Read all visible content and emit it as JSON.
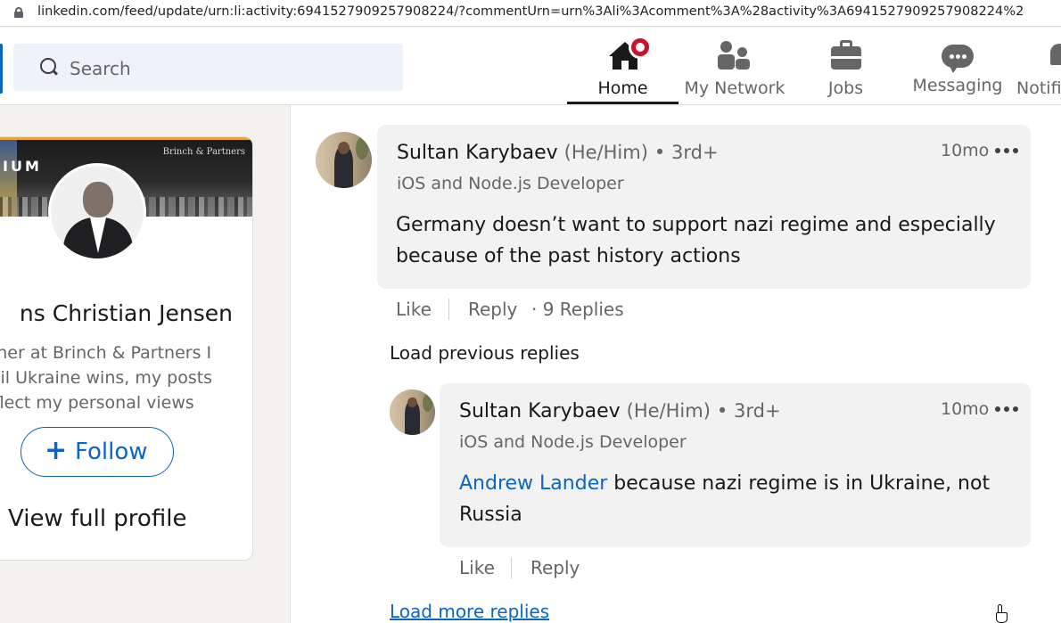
{
  "browser": {
    "url": "linkedin.com/feed/update/urn:li:activity:6941527909257908224/?commentUrn=urn%3Ali%3Acomment%3A%28activity%3A6941527909257908224%2"
  },
  "nav": {
    "search_placeholder": "Search",
    "items": [
      {
        "label": "Home",
        "icon": "home-icon",
        "active": true
      },
      {
        "label": "My Network",
        "icon": "people-icon"
      },
      {
        "label": "Jobs",
        "icon": "briefcase-icon"
      },
      {
        "label": "Messaging",
        "icon": "chat-bubble-icon"
      },
      {
        "label": "Notifi",
        "icon": "bell-icon"
      }
    ],
    "accent_color": "#0a66c2",
    "badge_color": "#cb112d"
  },
  "profile_card": {
    "banner_left_text": "IUM",
    "banner_right_text": "Brinch & Partners",
    "name": "ns Christian Jensen",
    "headline_lines": [
      "rtner at Brinch & Partners I",
      "ntil Ukraine wins, my posts",
      "eflect my personal views"
    ],
    "follow_label": "Follow",
    "follow_plus": "+",
    "view_profile_label": "View full profile"
  },
  "comments": [
    {
      "author": "Sultan Karybaev",
      "pronouns": "(He/Him)",
      "degree": "• 3rd+",
      "headline": "iOS and Node.js Developer",
      "time": "10mo",
      "text_lines": [
        "Germany doesn’t want to support nazi regime and especially",
        "because of the past history actions"
      ],
      "actions": {
        "like": "Like",
        "reply": "Reply",
        "replies": "· 9 Replies"
      }
    }
  ],
  "load_previous_label": "Load previous replies",
  "replies": [
    {
      "author": "Sultan Karybaev",
      "pronouns": "(He/Him)",
      "degree": "• 3rd+",
      "headline": "iOS and Node.js Developer",
      "time": "10mo",
      "mention": "Andrew Lander",
      "text_after_mention": " because nazi regime is in Ukraine, not",
      "text_line2": "Russia",
      "actions": {
        "like": "Like",
        "reply": "Reply"
      }
    }
  ],
  "load_more_label": "Load more replies"
}
